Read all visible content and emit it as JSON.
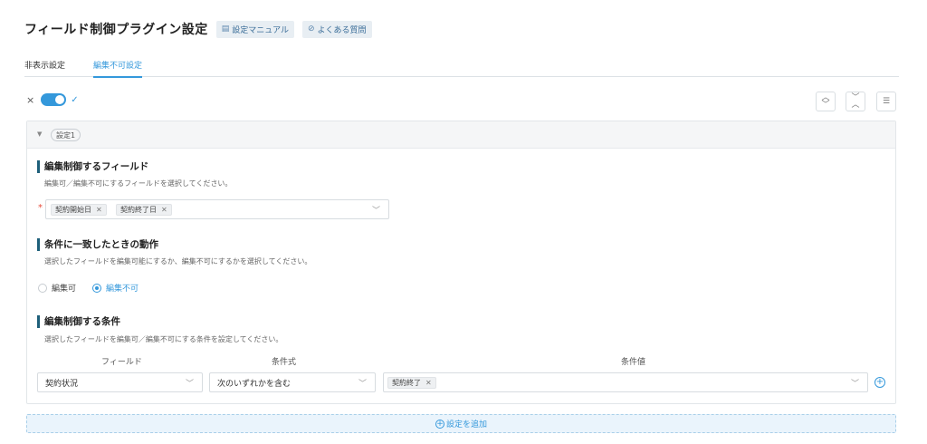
{
  "header": {
    "title": "フィールド制御プラグイン設定",
    "manual_label": "設定マニュアル",
    "faq_label": "よくある質問"
  },
  "tabs": [
    {
      "label": "非表示設定",
      "active": false
    },
    {
      "label": "編集不可設定",
      "active": true
    }
  ],
  "toggle": {
    "off_symbol": "×",
    "on_symbol": "✓",
    "enabled": true
  },
  "setting": {
    "pill_label": "設定1",
    "fields_section": {
      "title": "編集制御するフィールド",
      "description": "編集可／編集不可にするフィールドを選択してください。",
      "required_mark": "*",
      "selected": [
        "契約開始日",
        "契約終了日"
      ]
    },
    "action_section": {
      "title": "条件に一致したときの動作",
      "description": "選択したフィールドを編集可能にするか、編集不可にするかを選択してください。",
      "options": [
        {
          "label": "編集可",
          "selected": false
        },
        {
          "label": "編集不可",
          "selected": true
        }
      ]
    },
    "condition_section": {
      "title": "編集制御する条件",
      "description": "選択したフィールドを編集可／編集不可にする条件を設定してください。",
      "headers": {
        "field": "フィールド",
        "operator": "条件式",
        "value": "条件値"
      },
      "row": {
        "field": "契約状況",
        "operator": "次のいずれかを含む",
        "values": [
          "契約終了"
        ]
      }
    }
  },
  "add_setting_label": "設定を追加",
  "colors": {
    "accent": "#3498db",
    "section_bar": "#1e5f7a",
    "required": "#e74c3c"
  }
}
